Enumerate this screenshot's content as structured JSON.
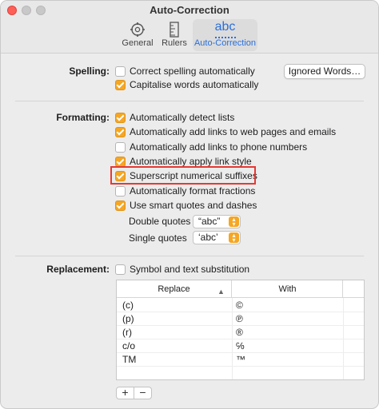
{
  "window": {
    "title": "Auto-Correction"
  },
  "toolbar": {
    "general_label": "General",
    "rulers_label": "Rulers",
    "autocorrection_label": "Auto-Correction",
    "autocorrection_icon_text": "abc",
    "accent_color": "#2a6fdb"
  },
  "spelling": {
    "section_label": "Spelling:",
    "correct_label": "Correct spelling automatically",
    "correct_checked": false,
    "capitalise_label": "Capitalise words automatically",
    "capitalise_checked": true,
    "ignored_words_button": "Ignored Words…"
  },
  "formatting": {
    "section_label": "Formatting:",
    "items": [
      {
        "label": "Automatically detect lists",
        "checked": true
      },
      {
        "label": "Automatically add links to web pages and emails",
        "checked": true
      },
      {
        "label": "Automatically add links to phone numbers",
        "checked": false
      },
      {
        "label": "Automatically apply link style",
        "checked": true
      },
      {
        "label": "Superscript numerical suffixes",
        "checked": true
      },
      {
        "label": "Automatically format fractions",
        "checked": false
      },
      {
        "label": "Use smart quotes and dashes",
        "checked": true
      }
    ],
    "double_quotes_label": "Double quotes",
    "double_quotes_value": "“abc”",
    "single_quotes_label": "Single quotes",
    "single_quotes_value": "‘abc’",
    "checkbox_color": "#f5a623",
    "highlight_color": "#e53935"
  },
  "replacement": {
    "section_label": "Replacement:",
    "symbol_label": "Symbol and text substitution",
    "symbol_checked": false,
    "columns": [
      "Replace",
      "With"
    ],
    "rows": [
      {
        "replace": "(c)",
        "with": "©"
      },
      {
        "replace": "(p)",
        "with": "℗"
      },
      {
        "replace": "(r)",
        "with": "®"
      },
      {
        "replace": "c/o",
        "with": "℅"
      },
      {
        "replace": "TM",
        "with": "™"
      }
    ],
    "add_label": "+",
    "remove_label": "−"
  }
}
